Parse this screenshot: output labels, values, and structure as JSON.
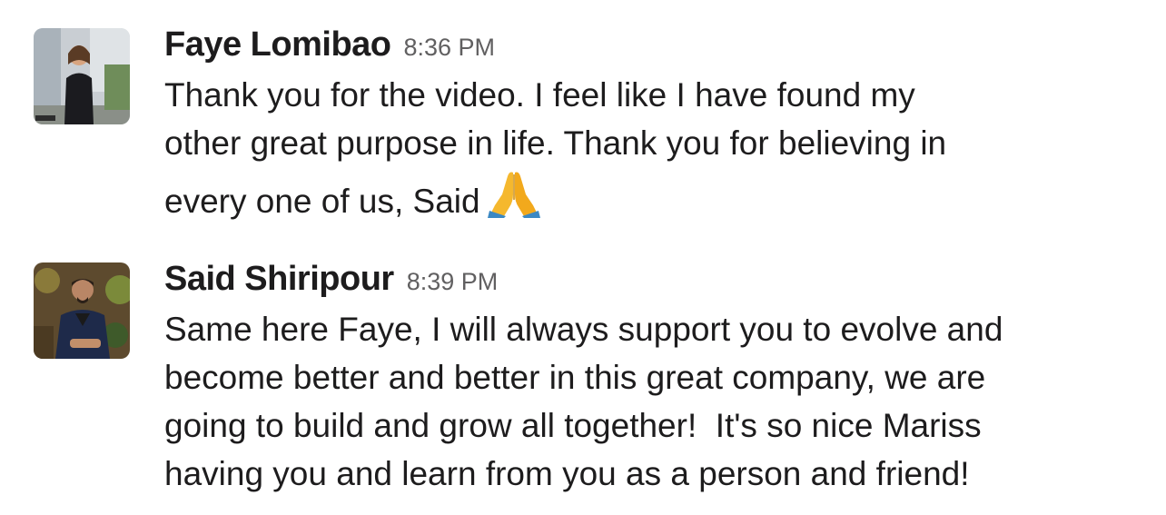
{
  "messages": [
    {
      "sender": "Faye Lomibao",
      "timestamp": "8:36 PM",
      "lines": [
        "Thank you for the video. I feel like I have found my",
        "other great purpose in life. Thank you for believing in",
        "every one of us, Said"
      ],
      "trailing_emoji": "folded-hands",
      "avatar_icon": "user-photo-avatar"
    },
    {
      "sender": "Said Shiripour",
      "timestamp": "8:39 PM",
      "lines": [
        "Same here Faye, I will always support you to evolve and",
        "become better and better in this great company, we are",
        "going to build and grow all together!  It's so nice Mariss",
        "having you and learn from you as a person and friend!"
      ],
      "avatar_icon": "user-photo-avatar"
    }
  ],
  "colors": {
    "text": "#1d1c1d",
    "timestamp": "#616061",
    "background": "#ffffff",
    "emoji_skin": "#f5b82e",
    "emoji_sleeve": "#3b88c3"
  }
}
